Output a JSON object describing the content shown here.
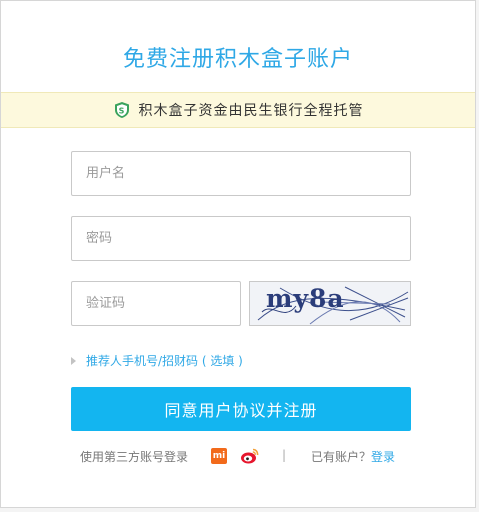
{
  "page": {
    "title": "免费注册积木盒子账户",
    "notice": "积木盒子资金由民生银行全程托管"
  },
  "form": {
    "username_placeholder": "用户名",
    "password_placeholder": "密码",
    "captcha_placeholder": "验证码",
    "captcha_text": "my8a",
    "referrer_link": "推荐人手机号/招财码 ( 选填 )",
    "submit_label": "同意用户协议并注册"
  },
  "footer": {
    "third_party_label": "使用第三方账号登录",
    "xiaomi_icon_text": "mi",
    "separator": "|",
    "has_account": "已有账户？",
    "login_link": "登录"
  },
  "colors": {
    "accent": "#2fa8e6",
    "button": "#13b5f0",
    "notice_bg": "#fdf9dd",
    "shield": "#3aa35c",
    "xiaomi": "#f26a1b",
    "weibo": "#e6162d"
  },
  "icons": [
    "shield-icon",
    "xiaomi-icon",
    "weibo-icon",
    "triangle-right-icon"
  ]
}
